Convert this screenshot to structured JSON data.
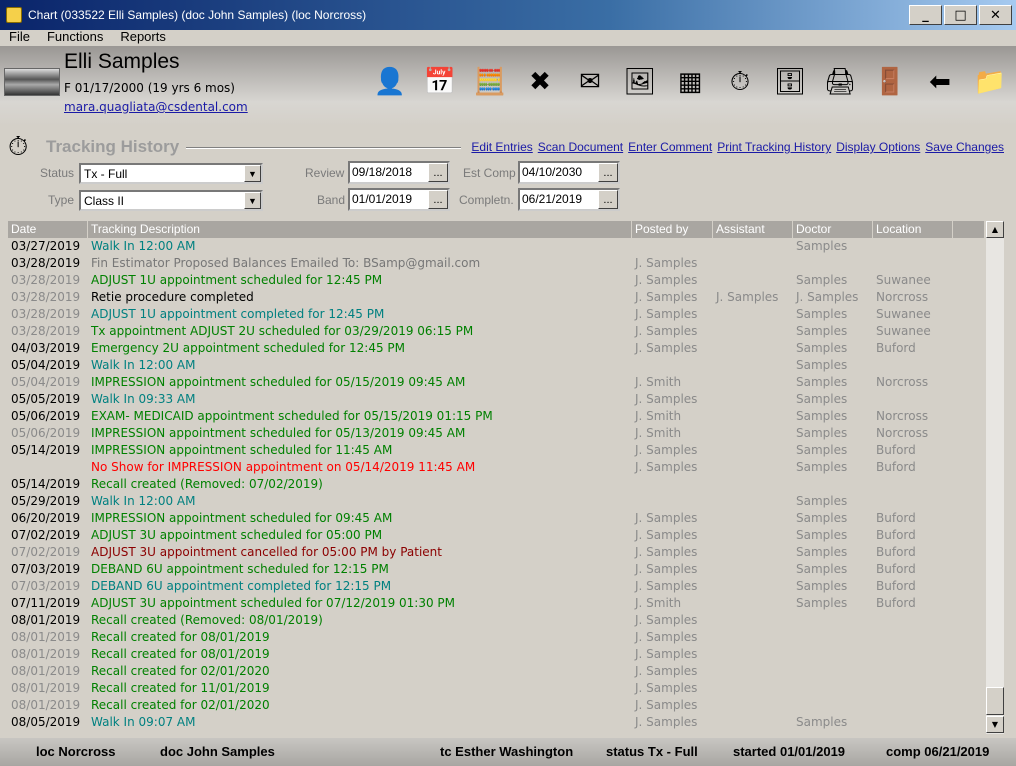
{
  "window": {
    "title": "Chart (033522  Elli Samples) (doc John Samples) (loc Norcross)",
    "min": "_",
    "max": "□",
    "close": "✕"
  },
  "menu": [
    "File",
    "Functions",
    "Reports"
  ],
  "patient": {
    "name": "Elli Samples",
    "info": "F  01/17/2000 (19 yrs 6 mos)",
    "email": "mara.quagliata@csdental.com"
  },
  "toolbar": [
    {
      "name": "patient-info-icon",
      "glyph": "👤"
    },
    {
      "name": "schedule-icon",
      "glyph": "📅"
    },
    {
      "name": "ledger-icon",
      "glyph": "🧮"
    },
    {
      "name": "delete-icon",
      "glyph": "✖"
    },
    {
      "name": "mail-icon",
      "glyph": "✉"
    },
    {
      "name": "image-icon",
      "glyph": "🖼"
    },
    {
      "name": "xray-icon",
      "glyph": "▦"
    },
    {
      "name": "tracking-icon",
      "glyph": "⏱"
    },
    {
      "name": "database-icon",
      "glyph": "🗄"
    },
    {
      "name": "scanner-icon",
      "glyph": "🖨"
    },
    {
      "name": "exit-door-icon",
      "glyph": "🚪"
    },
    {
      "name": "back-arrow-icon",
      "glyph": "⬅"
    },
    {
      "name": "folder-info-icon",
      "glyph": "📁"
    }
  ],
  "section": {
    "title": "Tracking History"
  },
  "links": [
    "Edit Entries",
    "Scan Document",
    "Enter Comment",
    "Print Tracking History",
    "Display Options",
    "Save Changes"
  ],
  "form": {
    "status_label": "Status",
    "status_value": "Tx - Full",
    "type_label": "Type",
    "type_value": "Class II",
    "review_label": "Review",
    "review_value": "09/18/2018",
    "band_label": "Band",
    "band_value": "01/01/2019",
    "estcomp_label": "Est Comp",
    "estcomp_value": "04/10/2030",
    "completn_label": "Completn.",
    "completn_value": "06/21/2019",
    "dots": "..."
  },
  "columns": [
    "Date",
    "Tracking Description",
    "Posted by",
    "Assistant",
    "Doctor",
    "Location"
  ],
  "rows": [
    {
      "date": "03/27/2019",
      "d": "dk",
      "desc": "Walk In  12:00 AM",
      "c": "teal",
      "posted": "",
      "assistant": "",
      "doctor": "Samples",
      "location": ""
    },
    {
      "date": "03/28/2019",
      "d": "dk",
      "desc": "Fin Estimator Proposed Balances Emailed To: BSamp@gmail.com",
      "c": "gray",
      "posted": "J. Samples",
      "assistant": "",
      "doctor": "",
      "location": ""
    },
    {
      "date": "03/28/2019",
      "d": "gy",
      "desc": "ADJUST 1U appointment scheduled for 12:45 PM",
      "c": "green",
      "posted": "J. Samples",
      "assistant": "",
      "doctor": "Samples",
      "location": "Suwanee"
    },
    {
      "date": "03/28/2019",
      "d": "gy",
      "desc": "Retie procedure completed",
      "c": "black",
      "posted": "J. Samples",
      "assistant": "J. Samples",
      "doctor": "J. Samples",
      "location": "Norcross"
    },
    {
      "date": "03/28/2019",
      "d": "gy",
      "desc": "ADJUST 1U appointment completed for 12:45 PM",
      "c": "teal",
      "posted": "J. Samples",
      "assistant": "",
      "doctor": "Samples",
      "location": "Suwanee"
    },
    {
      "date": "03/28/2019",
      "d": "gy",
      "desc": "Tx appointment ADJUST 2U scheduled for 03/29/2019 06:15 PM",
      "c": "green",
      "posted": "J. Samples",
      "assistant": "",
      "doctor": "Samples",
      "location": "Suwanee"
    },
    {
      "date": "04/03/2019",
      "d": "dk",
      "desc": "Emergency 2U appointment scheduled for 12:45 PM",
      "c": "green",
      "posted": "J. Samples",
      "assistant": "",
      "doctor": "Samples",
      "location": "Buford"
    },
    {
      "date": "05/04/2019",
      "d": "dk",
      "desc": "Walk In  12:00 AM",
      "c": "teal",
      "posted": "",
      "assistant": "",
      "doctor": "Samples",
      "location": ""
    },
    {
      "date": "05/04/2019",
      "d": "gy",
      "desc": "IMPRESSION appointment scheduled for 05/15/2019 09:45 AM",
      "c": "green",
      "posted": "J. Smith",
      "assistant": "",
      "doctor": "Samples",
      "location": "Norcross"
    },
    {
      "date": "05/05/2019",
      "d": "dk",
      "desc": "Walk In 09:33 AM",
      "c": "teal",
      "posted": "J. Samples",
      "assistant": "",
      "doctor": "Samples",
      "location": ""
    },
    {
      "date": "05/06/2019",
      "d": "dk",
      "desc": "EXAM- MEDICAID appointment scheduled for 05/15/2019 01:15 PM",
      "c": "green",
      "posted": "J. Smith",
      "assistant": "",
      "doctor": "Samples",
      "location": "Norcross"
    },
    {
      "date": "05/06/2019",
      "d": "gy",
      "desc": "IMPRESSION appointment scheduled for 05/13/2019 09:45 AM",
      "c": "green",
      "posted": "J. Smith",
      "assistant": "",
      "doctor": "Samples",
      "location": "Norcross"
    },
    {
      "date": "05/14/2019",
      "d": "dk",
      "desc": "IMPRESSION appointment scheduled for 11:45 AM",
      "c": "green",
      "posted": "J. Samples",
      "assistant": "",
      "doctor": "Samples",
      "location": "Buford"
    },
    {
      "date": "",
      "d": "dk",
      "desc": "No Show for IMPRESSION appointment on 05/14/2019 11:45 AM",
      "c": "red",
      "posted": "J. Samples",
      "assistant": "",
      "doctor": "Samples",
      "location": "Buford"
    },
    {
      "date": "05/14/2019",
      "d": "dk",
      "desc": "Recall created (Removed: 07/02/2019)",
      "c": "green",
      "posted": "",
      "assistant": "",
      "doctor": "",
      "location": ""
    },
    {
      "date": "05/29/2019",
      "d": "dk",
      "desc": "Walk In  12:00 AM",
      "c": "teal",
      "posted": "",
      "assistant": "",
      "doctor": "Samples",
      "location": ""
    },
    {
      "date": "06/20/2019",
      "d": "dk",
      "desc": "IMPRESSION appointment scheduled for 09:45 AM",
      "c": "green",
      "posted": "J. Samples",
      "assistant": "",
      "doctor": "Samples",
      "location": "Buford"
    },
    {
      "date": "07/02/2019",
      "d": "dk",
      "desc": "ADJUST 3U appointment scheduled for 05:00 PM",
      "c": "green",
      "posted": "J. Samples",
      "assistant": "",
      "doctor": "Samples",
      "location": "Buford"
    },
    {
      "date": "07/02/2019",
      "d": "gy",
      "desc": "ADJUST 3U appointment cancelled for 05:00 PM  by Patient",
      "c": "maroon",
      "posted": "J. Samples",
      "assistant": "",
      "doctor": "Samples",
      "location": "Buford"
    },
    {
      "date": "07/03/2019",
      "d": "dk",
      "desc": "DEBAND 6U appointment scheduled for 12:15 PM",
      "c": "green",
      "posted": "J. Samples",
      "assistant": "",
      "doctor": "Samples",
      "location": "Buford"
    },
    {
      "date": "07/03/2019",
      "d": "gy",
      "desc": "DEBAND 6U appointment completed for 12:15 PM",
      "c": "teal",
      "posted": "J. Samples",
      "assistant": "",
      "doctor": "Samples",
      "location": "Buford"
    },
    {
      "date": "07/11/2019",
      "d": "dk",
      "desc": "ADJUST 3U appointment scheduled for 07/12/2019 01:30 PM",
      "c": "green",
      "posted": "J. Smith",
      "assistant": "",
      "doctor": "Samples",
      "location": "Buford"
    },
    {
      "date": "08/01/2019",
      "d": "dk",
      "desc": "Recall created (Removed: 08/01/2019)",
      "c": "green",
      "posted": "J. Samples",
      "assistant": "",
      "doctor": "",
      "location": ""
    },
    {
      "date": "08/01/2019",
      "d": "gy",
      "desc": "Recall created for 08/01/2019",
      "c": "green",
      "posted": "J. Samples",
      "assistant": "",
      "doctor": "",
      "location": ""
    },
    {
      "date": "08/01/2019",
      "d": "gy",
      "desc": "Recall created for 08/01/2019",
      "c": "green",
      "posted": "J. Samples",
      "assistant": "",
      "doctor": "",
      "location": ""
    },
    {
      "date": "08/01/2019",
      "d": "gy",
      "desc": "Recall created for 02/01/2020",
      "c": "green",
      "posted": "J. Samples",
      "assistant": "",
      "doctor": "",
      "location": ""
    },
    {
      "date": "08/01/2019",
      "d": "gy",
      "desc": "Recall created for 11/01/2019",
      "c": "green",
      "posted": "J. Samples",
      "assistant": "",
      "doctor": "",
      "location": ""
    },
    {
      "date": "08/01/2019",
      "d": "gy",
      "desc": "Recall created for 02/01/2020",
      "c": "green",
      "posted": "J. Samples",
      "assistant": "",
      "doctor": "",
      "location": ""
    },
    {
      "date": "08/05/2019",
      "d": "dk",
      "desc": "Walk In 09:07 AM",
      "c": "teal",
      "posted": "J. Samples",
      "assistant": "",
      "doctor": "Samples",
      "location": ""
    }
  ],
  "status": {
    "loc": "loc Norcross",
    "doc": "doc John Samples",
    "tc": "tc Esther Washington",
    "status": "status Tx - Full",
    "started": "started 01/01/2019",
    "comp": "comp 06/21/2019"
  },
  "scroll": {
    "up": "▲",
    "down": "▼"
  }
}
